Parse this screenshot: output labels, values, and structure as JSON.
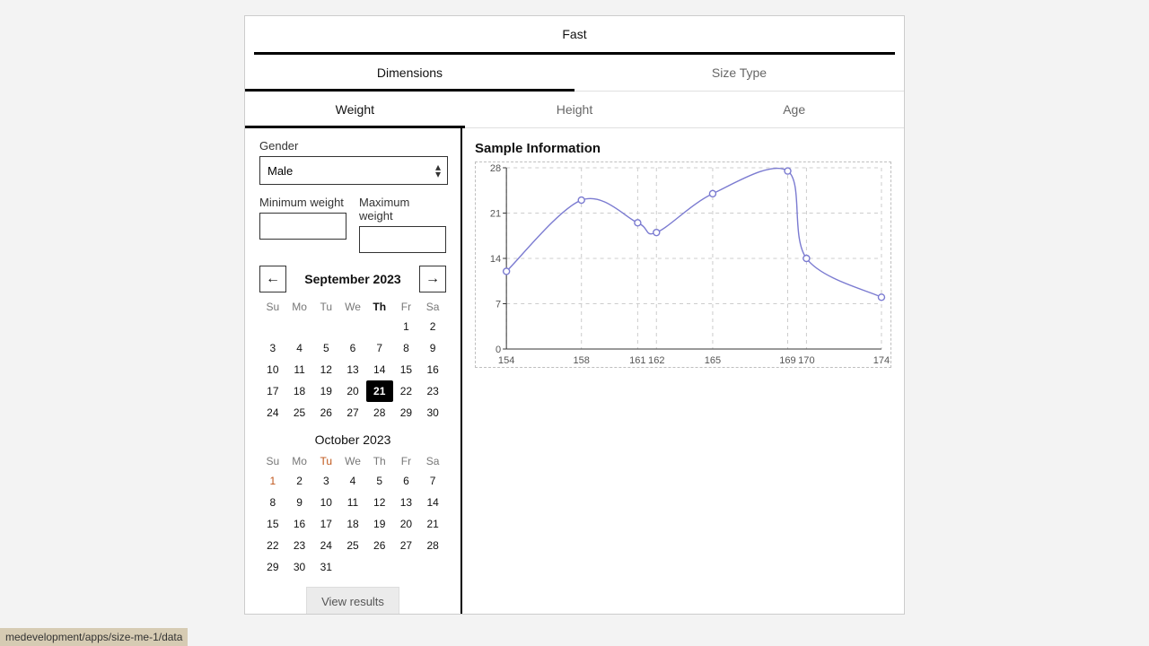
{
  "topbar": {
    "title": "Fast"
  },
  "tabs": {
    "items": [
      "Dimensions",
      "Size Type"
    ],
    "active": 0
  },
  "subtabs": {
    "items": [
      "Weight",
      "Height",
      "Age"
    ],
    "active": 0
  },
  "form": {
    "gender_label": "Gender",
    "gender_value": "Male",
    "min_label": "Minimum weight",
    "max_label": "Maximum weight",
    "view_results": "View results"
  },
  "calendar1": {
    "title": "September 2023",
    "dow": [
      "Su",
      "Mo",
      "Tu",
      "We",
      "Th",
      "Fr",
      "Sa"
    ],
    "today_dow_index": 4,
    "start_offset": 5,
    "days": 30,
    "selected": 21,
    "today": 21
  },
  "calendar2": {
    "title": "October 2023",
    "dow": [
      "Su",
      "Mo",
      "Tu",
      "We",
      "Th",
      "Fr",
      "Sa"
    ],
    "start_offset": 0,
    "days": 31,
    "holiday_dow_index": 2,
    "holiday_days": [
      1
    ]
  },
  "chart_title": "Sample Information",
  "chart_data": {
    "type": "line",
    "x": [
      154,
      158,
      161,
      162,
      165,
      169,
      170,
      174
    ],
    "values": [
      12,
      23,
      19.5,
      18,
      24,
      27.5,
      14,
      8
    ],
    "xlabel": "",
    "ylabel": "",
    "xlim": [
      154,
      174
    ],
    "ylim": [
      0,
      28
    ],
    "yticks": [
      0,
      7,
      14,
      21,
      28
    ],
    "xticks": [
      154,
      158,
      161,
      162,
      165,
      169,
      170,
      174
    ]
  },
  "footer_path": "medevelopment/apps/size-me-1/data"
}
